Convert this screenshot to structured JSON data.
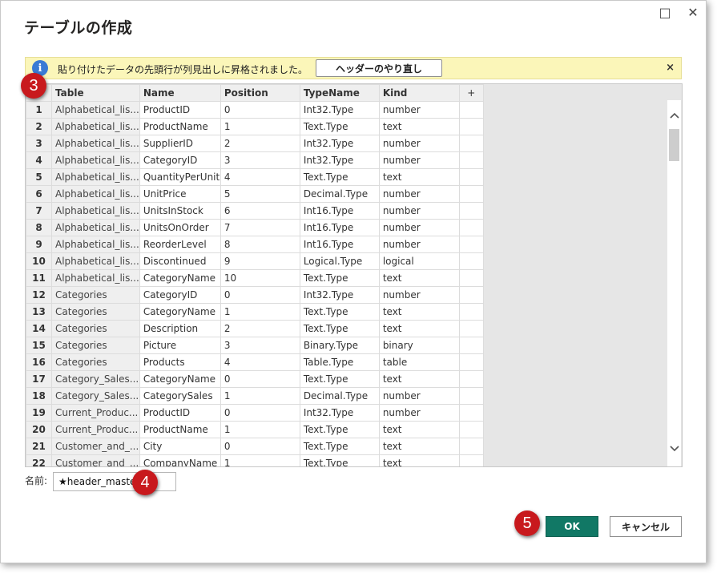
{
  "window": {
    "title": "テーブルの作成",
    "maximize_icon": "□",
    "close_icon": "✕"
  },
  "infobar": {
    "icon": "i",
    "message": "貼り付けたデータの先頭行が列見出しに昇格されました。",
    "button_label": "ヘッダーのやり直し",
    "close_icon": "×"
  },
  "grid": {
    "columns": [
      "Table",
      "Name",
      "Position",
      "TypeName",
      "Kind"
    ],
    "add_column": "+",
    "rows": [
      [
        "1",
        "Alphabetical_lis...",
        "ProductID",
        "0",
        "Int32.Type",
        "number"
      ],
      [
        "2",
        "Alphabetical_lis...",
        "ProductName",
        "1",
        "Text.Type",
        "text"
      ],
      [
        "3",
        "Alphabetical_lis...",
        "SupplierID",
        "2",
        "Int32.Type",
        "number"
      ],
      [
        "4",
        "Alphabetical_lis...",
        "CategoryID",
        "3",
        "Int32.Type",
        "number"
      ],
      [
        "5",
        "Alphabetical_lis...",
        "QuantityPerUnit",
        "4",
        "Text.Type",
        "text"
      ],
      [
        "6",
        "Alphabetical_lis...",
        "UnitPrice",
        "5",
        "Decimal.Type",
        "number"
      ],
      [
        "7",
        "Alphabetical_lis...",
        "UnitsInStock",
        "6",
        "Int16.Type",
        "number"
      ],
      [
        "8",
        "Alphabetical_lis...",
        "UnitsOnOrder",
        "7",
        "Int16.Type",
        "number"
      ],
      [
        "9",
        "Alphabetical_lis...",
        "ReorderLevel",
        "8",
        "Int16.Type",
        "number"
      ],
      [
        "10",
        "Alphabetical_lis...",
        "Discontinued",
        "9",
        "Logical.Type",
        "logical"
      ],
      [
        "11",
        "Alphabetical_lis...",
        "CategoryName",
        "10",
        "Text.Type",
        "text"
      ],
      [
        "12",
        "Categories",
        "CategoryID",
        "0",
        "Int32.Type",
        "number"
      ],
      [
        "13",
        "Categories",
        "CategoryName",
        "1",
        "Text.Type",
        "text"
      ],
      [
        "14",
        "Categories",
        "Description",
        "2",
        "Text.Type",
        "text"
      ],
      [
        "15",
        "Categories",
        "Picture",
        "3",
        "Binary.Type",
        "binary"
      ],
      [
        "16",
        "Categories",
        "Products",
        "4",
        "Table.Type",
        "table"
      ],
      [
        "17",
        "Category_Sales...",
        "CategoryName",
        "0",
        "Text.Type",
        "text"
      ],
      [
        "18",
        "Category_Sales...",
        "CategorySales",
        "1",
        "Decimal.Type",
        "number"
      ],
      [
        "19",
        "Current_Produc...",
        "ProductID",
        "0",
        "Int32.Type",
        "number"
      ],
      [
        "20",
        "Current_Produc...",
        "ProductName",
        "1",
        "Text.Type",
        "text"
      ],
      [
        "21",
        "Customer_and_...",
        "City",
        "0",
        "Text.Type",
        "text"
      ],
      [
        "22",
        "Customer_and_...",
        "CompanyName",
        "1",
        "Text.Type",
        "text"
      ]
    ]
  },
  "name_field": {
    "label": "名前:",
    "value": "★header_master"
  },
  "buttons": {
    "ok": "OK",
    "cancel": "キャンセル"
  },
  "markers": {
    "grid": "3",
    "name": "4",
    "ok": "5"
  },
  "colors": {
    "ok_button": "#117865",
    "infobar_bg": "#fbf6b9",
    "marker": "#c8191d"
  },
  "icons": {
    "scroll_up": "chevron-up-icon",
    "scroll_down": "chevron-down-icon",
    "info": "info-icon"
  }
}
